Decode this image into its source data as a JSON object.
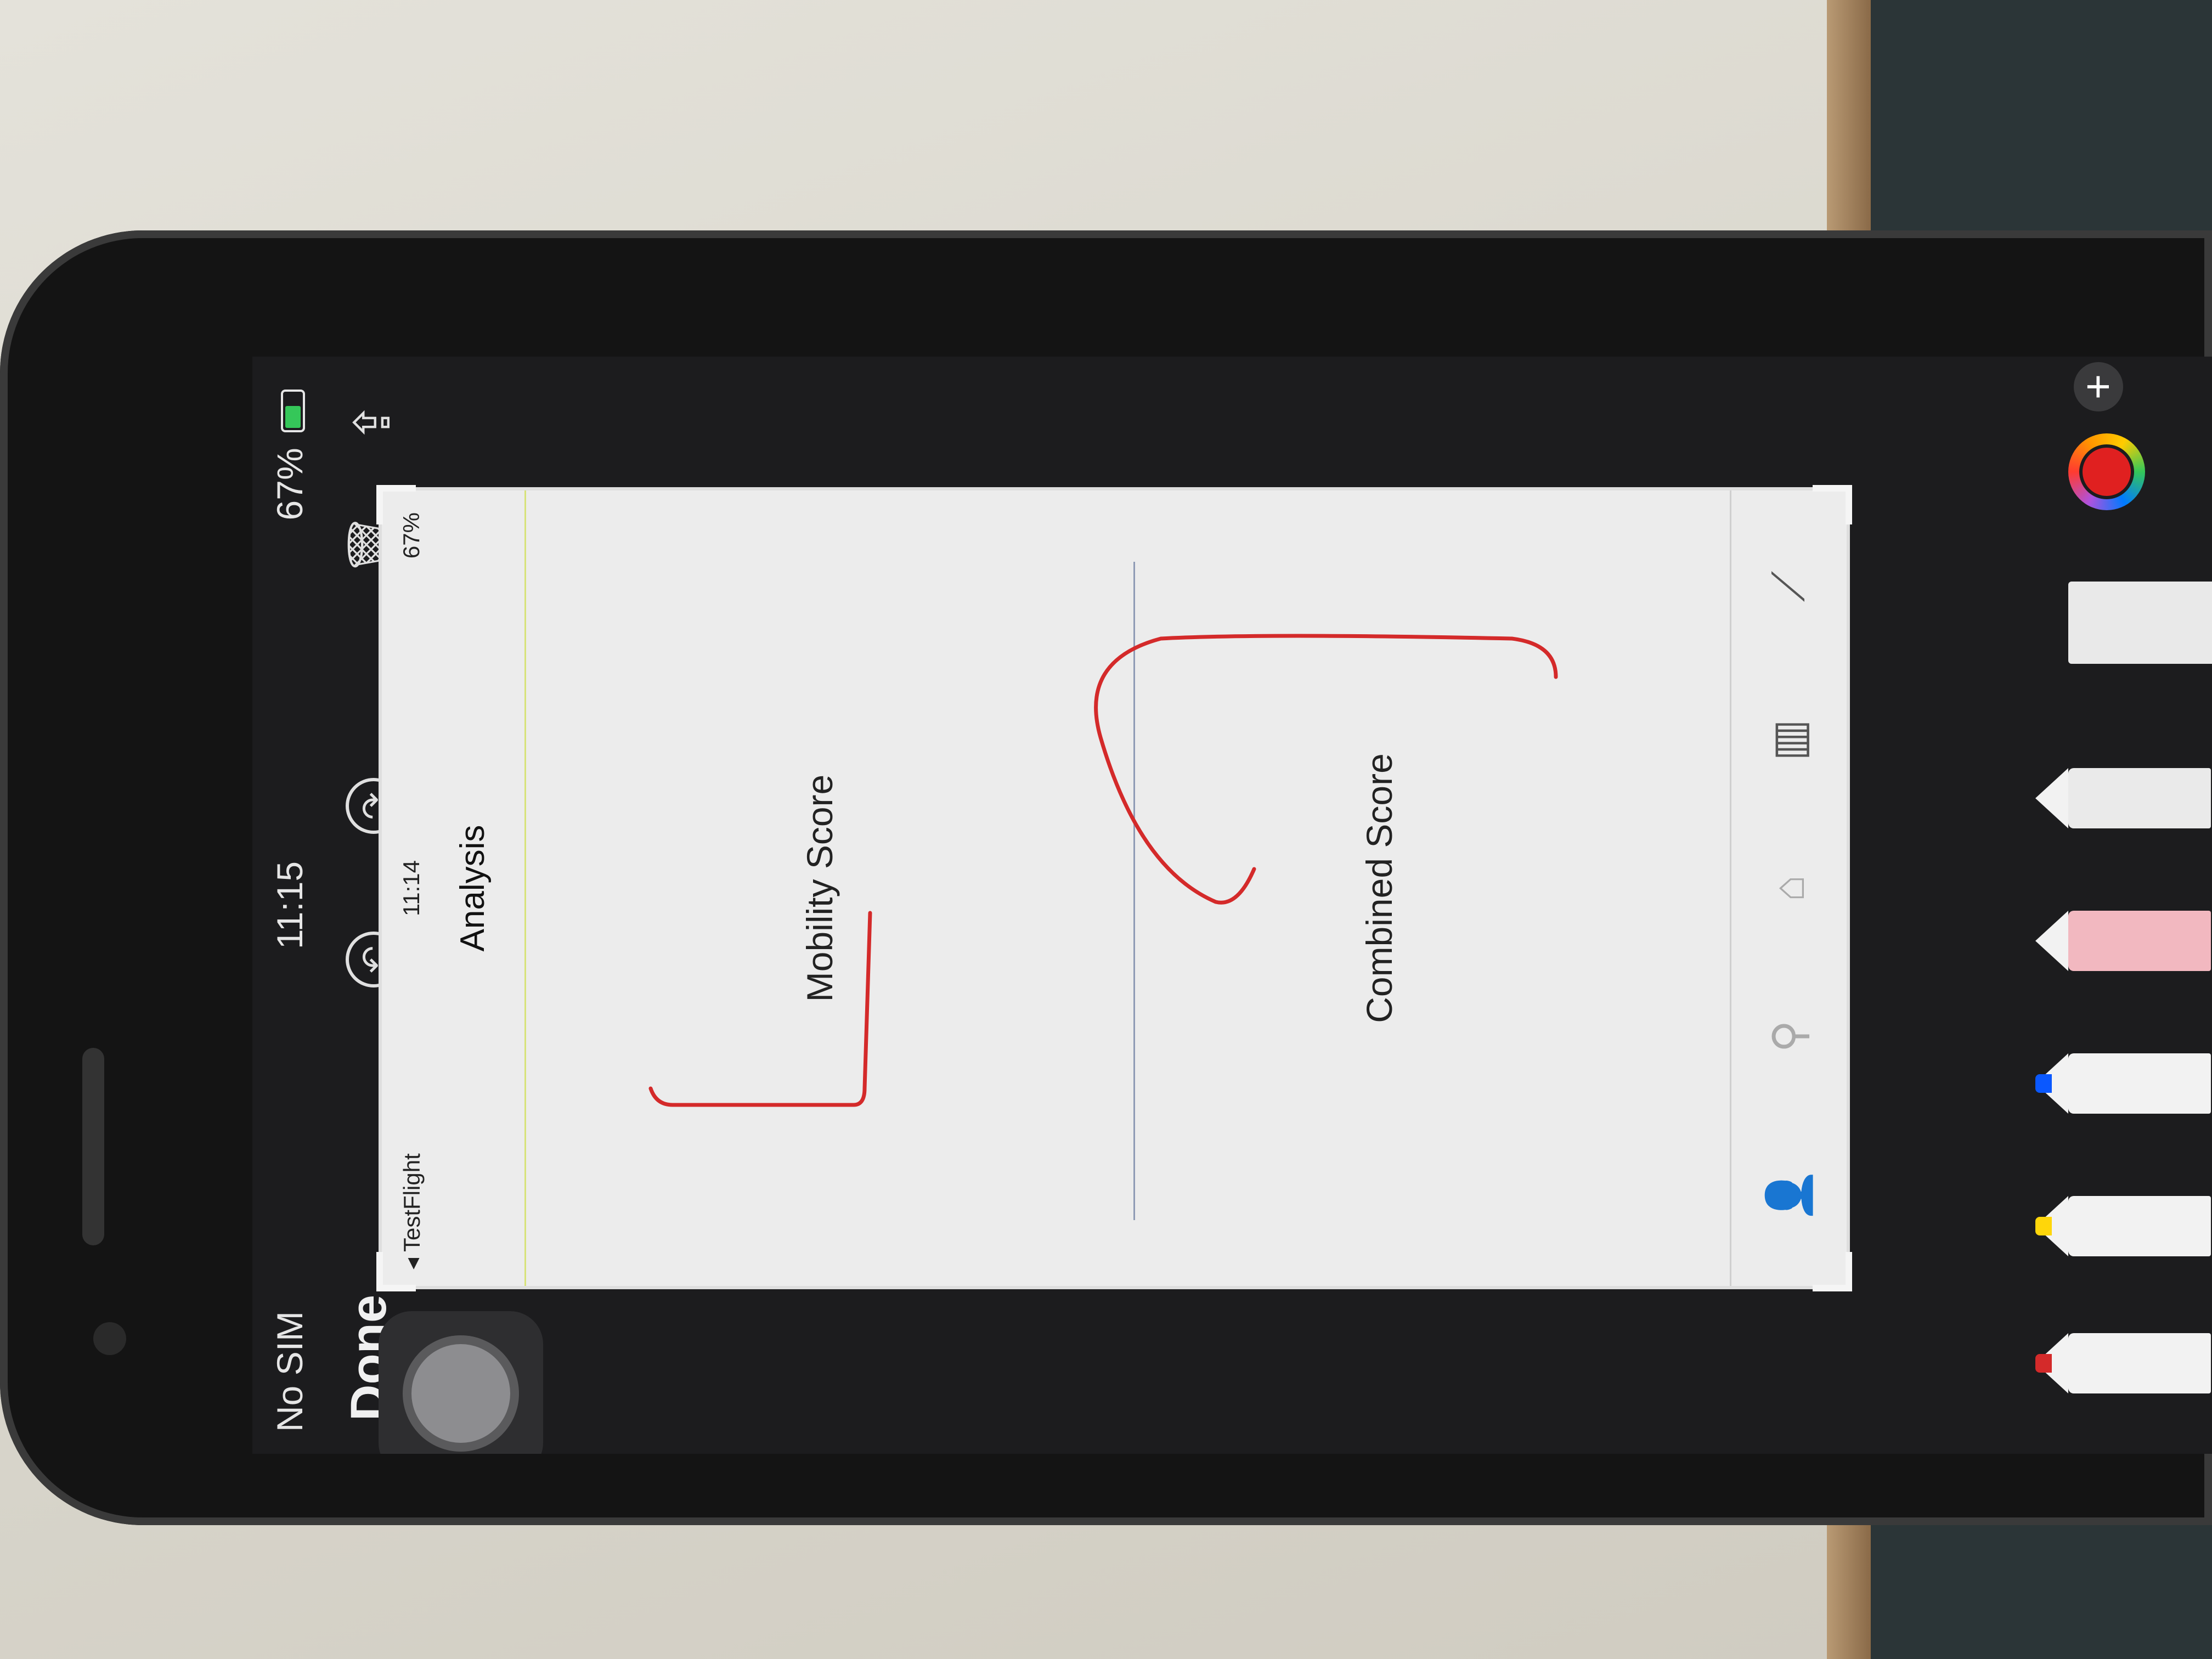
{
  "status_bar": {
    "carrier": "No SIM",
    "time": "11:15",
    "battery": "67%"
  },
  "toolbar": {
    "done_label": "Done"
  },
  "screenshot": {
    "status": {
      "back_app": "◂ TestFlight",
      "time": "11:14",
      "battery": "67%"
    },
    "title": "Analysis",
    "cards": [
      {
        "label": "Mobility Score"
      },
      {
        "label": "Combined Score"
      }
    ],
    "tabs": [
      "person-icon",
      "dumbbell-icon",
      "home-icon",
      "bar-chart-icon",
      "line-chart-icon"
    ]
  },
  "markup_tools": [
    "pen",
    "marker",
    "pencil",
    "eraser",
    "lasso",
    "ruler"
  ],
  "colors": {
    "markup_stroke": "#d42a2a",
    "accent_green": "#35c759",
    "screen_bg": "#1c1c1e"
  }
}
